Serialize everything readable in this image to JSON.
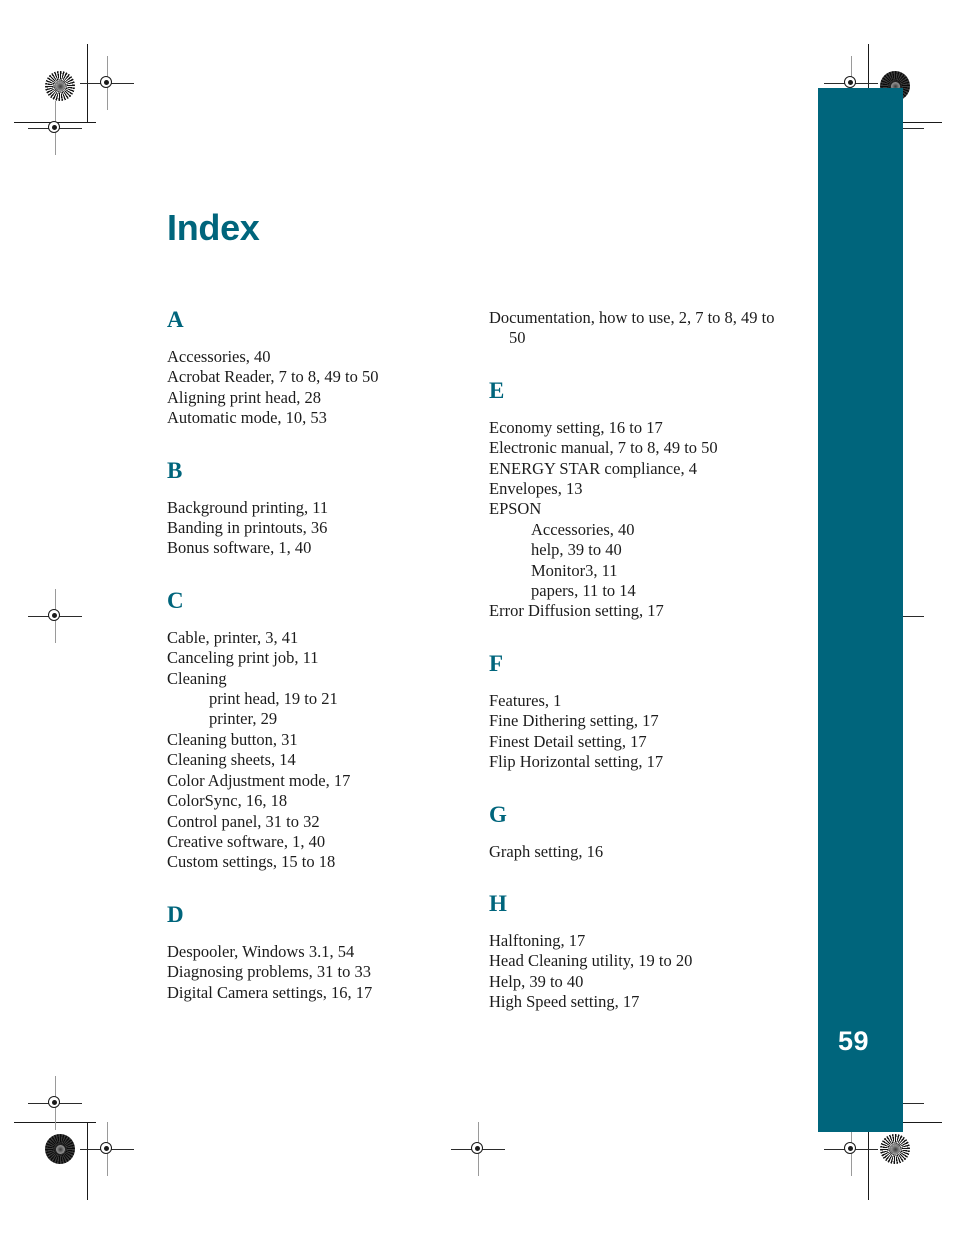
{
  "document": {
    "title": "Index",
    "folio": "59",
    "accent_color": "#00657c",
    "text_color": "#1c1c1c",
    "page_background": "#ffffff"
  },
  "columns": {
    "left": [
      {
        "letter": "A",
        "entries": [
          {
            "text": "Accessories, 40",
            "level": 0
          },
          {
            "text": "Acrobat Reader, 7 to 8, 49 to 50",
            "level": 0
          },
          {
            "text": "Aligning print head, 28",
            "level": 0
          },
          {
            "text": "Automatic mode, 10, 53",
            "level": 0
          }
        ]
      },
      {
        "letter": "B",
        "entries": [
          {
            "text": "Background printing, 11",
            "level": 0
          },
          {
            "text": "Banding in printouts, 36",
            "level": 0
          },
          {
            "text": "Bonus software, 1, 40",
            "level": 0
          }
        ]
      },
      {
        "letter": "C",
        "entries": [
          {
            "text": "Cable, printer, 3, 41",
            "level": 0
          },
          {
            "text": "Canceling print job, 11",
            "level": 0
          },
          {
            "text": "Cleaning",
            "level": 0
          },
          {
            "text": "print head, 19 to 21",
            "level": 1
          },
          {
            "text": "printer, 29",
            "level": 1
          },
          {
            "text": "Cleaning button, 31",
            "level": 0
          },
          {
            "text": "Cleaning sheets, 14",
            "level": 0
          },
          {
            "text": "Color Adjustment mode, 17",
            "level": 0
          },
          {
            "text": "ColorSync, 16, 18",
            "level": 0
          },
          {
            "text": "Control panel, 31 to 32",
            "level": 0
          },
          {
            "text": "Creative software, 1, 40",
            "level": 0
          },
          {
            "text": "Custom settings, 15 to 18",
            "level": 0
          }
        ]
      },
      {
        "letter": "D",
        "entries": [
          {
            "text": "Despooler, Windows 3.1, 54",
            "level": 0
          },
          {
            "text": "Diagnosing problems, 31 to 33",
            "level": 0
          },
          {
            "text": "Digital Camera settings, 16, 17",
            "level": 0
          }
        ]
      }
    ],
    "right": [
      {
        "letter": "",
        "entries": [
          {
            "text": "Documentation, how to use, 2, 7 to 8, 49 to 50",
            "level": 0
          }
        ]
      },
      {
        "letter": "E",
        "entries": [
          {
            "text": "Economy setting, 16 to 17",
            "level": 0
          },
          {
            "text": "Electronic manual, 7 to 8, 49 to 50",
            "level": 0
          },
          {
            "text": "ENERGY STAR compliance, 4",
            "level": 0
          },
          {
            "text": "Envelopes, 13",
            "level": 0
          },
          {
            "text": "EPSON",
            "level": 0
          },
          {
            "text": "Accessories, 40",
            "level": 1
          },
          {
            "text": "help, 39 to 40",
            "level": 1
          },
          {
            "text": "Monitor3, 11",
            "level": 1
          },
          {
            "text": "papers, 11 to 14",
            "level": 1
          },
          {
            "text": "Error Diffusion setting, 17",
            "level": 0
          }
        ]
      },
      {
        "letter": "F",
        "entries": [
          {
            "text": "Features, 1",
            "level": 0
          },
          {
            "text": "Fine Dithering setting, 17",
            "level": 0
          },
          {
            "text": "Finest Detail setting, 17",
            "level": 0
          },
          {
            "text": "Flip Horizontal setting, 17",
            "level": 0
          }
        ]
      },
      {
        "letter": "G",
        "entries": [
          {
            "text": "Graph setting, 16",
            "level": 0
          }
        ]
      },
      {
        "letter": "H",
        "entries": [
          {
            "text": "Halftoning, 17",
            "level": 0
          },
          {
            "text": "Head Cleaning utility, 19 to 20",
            "level": 0
          },
          {
            "text": "Help, 39 to 40",
            "level": 0
          },
          {
            "text": "High Speed setting, 17",
            "level": 0
          }
        ]
      }
    ]
  },
  "press_marks": {
    "registration_targets": 10,
    "star_targets": 4,
    "description": "printer registration and crop marks"
  }
}
